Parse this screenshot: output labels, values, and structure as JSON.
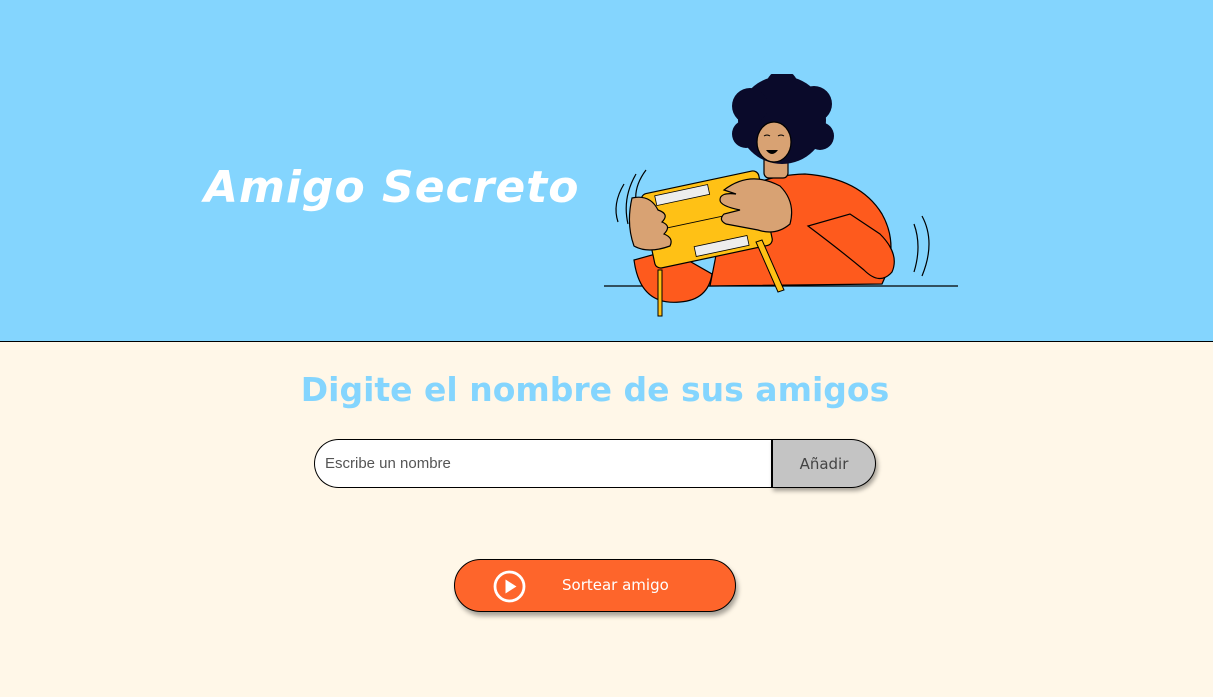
{
  "header": {
    "title": "Amigo Secreto",
    "background_color": "#84D5FE",
    "illustration": "person-holding-gift-box-illustration"
  },
  "main": {
    "heading": "Digite el nombre de sus amigos",
    "heading_color": "#84D5FE",
    "background_color": "#FFF7E8",
    "name_input": {
      "placeholder": "Escribe un nombre",
      "value": ""
    },
    "add_button": {
      "label": "Añadir",
      "color": "#C4C4C4"
    },
    "draw_button": {
      "label": "Sortear amigo",
      "icon": "play-circle-icon",
      "color": "#FE652B"
    }
  }
}
